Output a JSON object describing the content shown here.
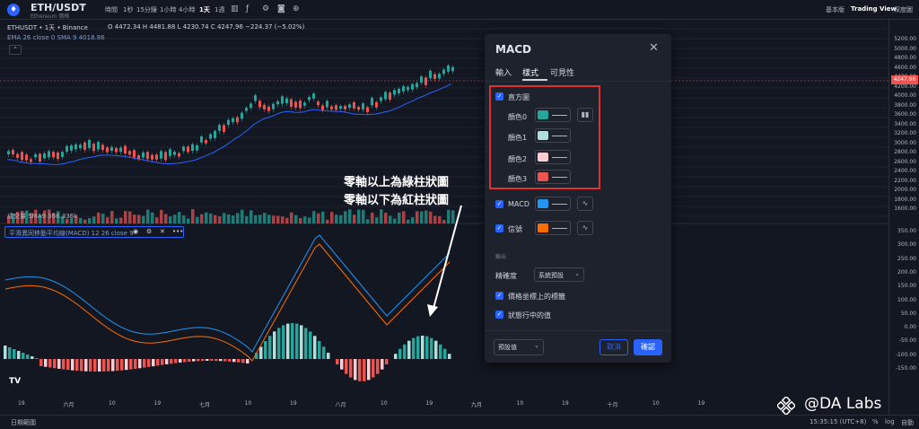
{
  "topbar": {
    "symbol": "ETH/USDT",
    "symbol_sub": "Ethereum 價格",
    "timeframes": [
      "時間",
      "1秒",
      "15分鐘",
      "1小時",
      "4小時",
      "1天",
      "1週"
    ],
    "active_timeframe": "1天",
    "right_links": [
      "基本版",
      "Trading View",
      "深度圖"
    ]
  },
  "legend": {
    "title": "ETHUSDT • 1天 • Binance",
    "ohlc": "O 4472.34  H 4481.88  L 4230.74  C 4247.96  −224.37 (−5.02%)",
    "ema": "EMA 26 close 0 SMA 9  4018.86",
    "volume": "成交量 SMA9  366.336k",
    "macd": "平滑異同移動平均線(MACD) 12 26 close 9"
  },
  "price_axis": {
    "ticks": [
      "5200.00",
      "5000.00",
      "4800.00",
      "4600.00",
      "4400.00",
      "4200.00",
      "4000.00",
      "3800.00",
      "3600.00",
      "3400.00",
      "3200.00",
      "3000.00",
      "2800.00",
      "2600.00",
      "2400.00",
      "2200.00",
      "2000.00",
      "1800.00",
      "1600.00",
      "350.00",
      "300.00",
      "250.00",
      "200.00",
      "150.00",
      "100.00",
      "50.00",
      "0.00",
      "-50.00",
      "-100.00",
      "-150.00"
    ],
    "last_price": "4247.96"
  },
  "time_axis": {
    "ticks": [
      "19",
      "六月",
      "10",
      "19",
      "七月",
      "10",
      "19",
      "八月",
      "10",
      "19",
      "九月",
      "10",
      "19",
      "十月",
      "10",
      "19"
    ]
  },
  "bottombar": {
    "left": "日期範圍",
    "time": "15:35:15 (UTC+8)",
    "pct": "%",
    "log": "log",
    "auto": "自動"
  },
  "annotation": {
    "line1": "零軸以上為綠柱狀圖",
    "line2": "零軸以下為紅柱狀圖"
  },
  "dialog": {
    "title": "MACD",
    "tabs": [
      "輸入",
      "樣式",
      "可見性"
    ],
    "active_tab": "樣式",
    "histogram_label": "直方圖",
    "colors": [
      {
        "label": "顏色0",
        "color": "#26a69a"
      },
      {
        "label": "顏色1",
        "color": "#b2dfdb"
      },
      {
        "label": "顏色2",
        "color": "#ffcdd2"
      },
      {
        "label": "顏色3",
        "color": "#ef5350"
      }
    ],
    "macd_label": "MACD",
    "macd_color": "#2196f3",
    "signal_label": "信號",
    "signal_color": "#ff6d00",
    "section_output": "輸出",
    "precision_label": "精確度",
    "precision_value": "系統預設",
    "opt1": "價格坐標上的標籤",
    "opt2": "狀態行中的值",
    "defaults_label": "預設值",
    "cancel": "取消",
    "ok": "確認"
  },
  "watermark": "@DA Labs"
}
